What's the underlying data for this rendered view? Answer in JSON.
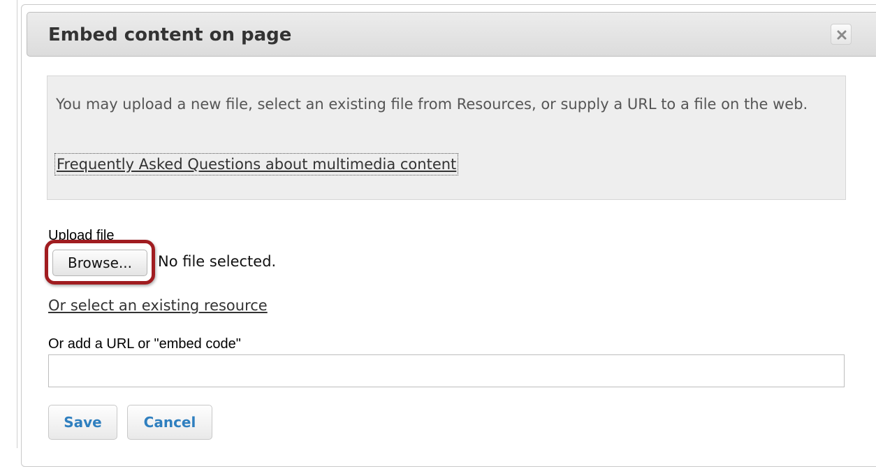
{
  "dialog": {
    "title": "Embed content on page",
    "close_icon": "close-x-icon"
  },
  "info": {
    "text": "You may upload a new file, select an existing file from Resources, or supply a URL to a file on the web.",
    "faq_link": "Frequently Asked Questions about multimedia content"
  },
  "upload": {
    "label": "Upload file",
    "browse_label": "Browse...",
    "file_status": "No file selected.",
    "highlight_color": "#a01c20"
  },
  "resource": {
    "link": "Or select an existing resource"
  },
  "url": {
    "label": "Or add a URL or \"embed code\"",
    "value": ""
  },
  "actions": {
    "save_label": "Save",
    "cancel_label": "Cancel",
    "accent_color": "#2f7fbf"
  }
}
